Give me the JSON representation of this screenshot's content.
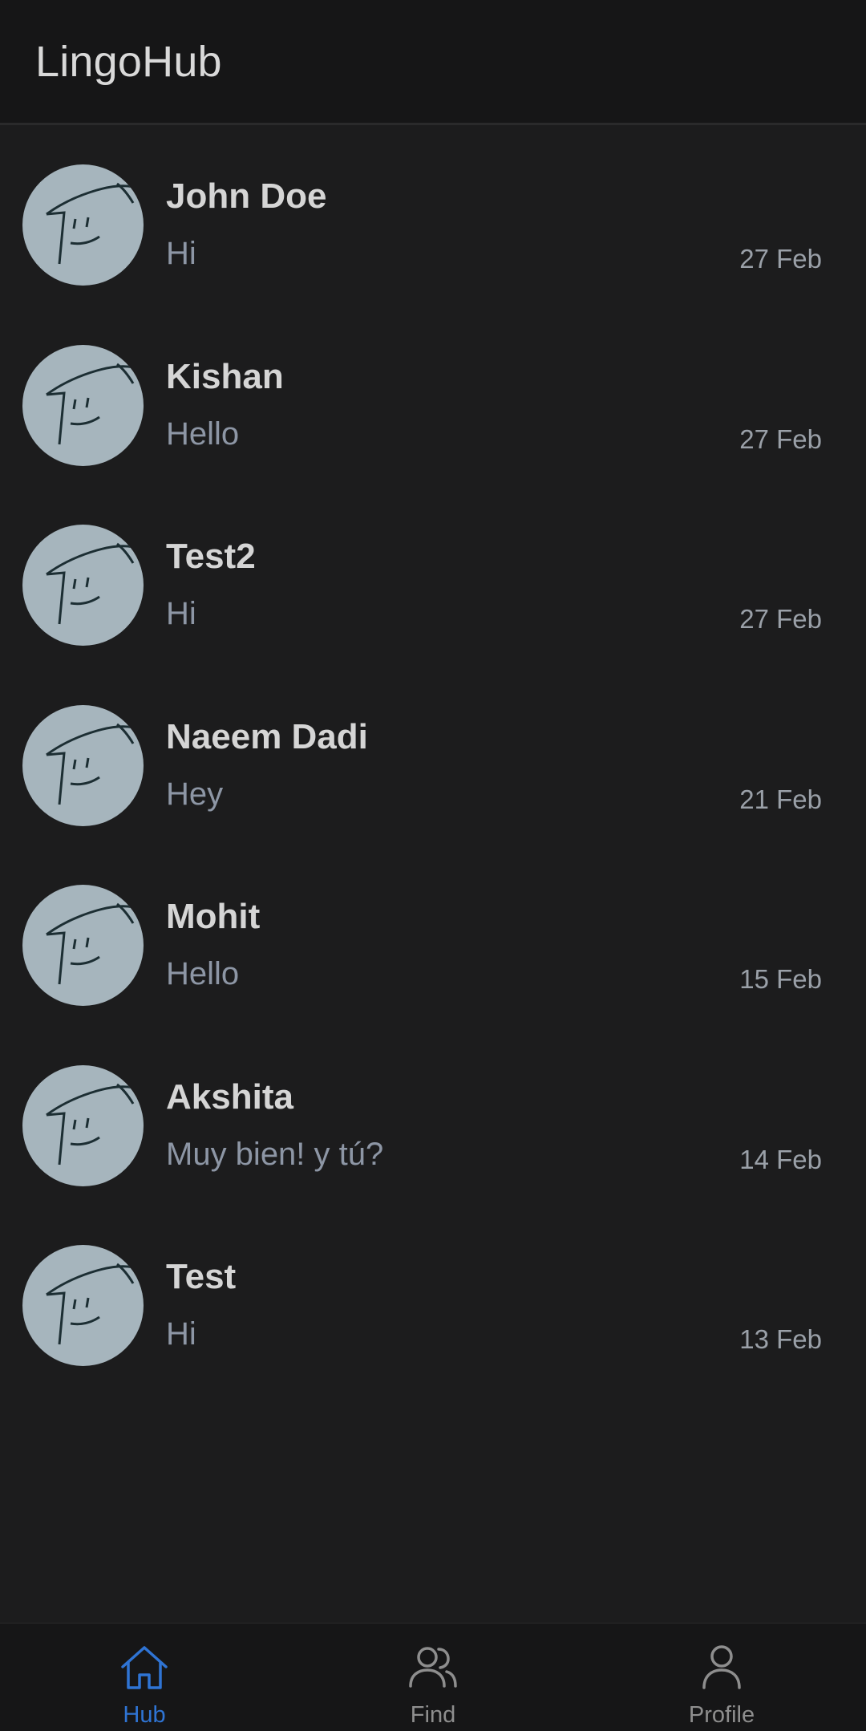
{
  "app_bar": {
    "title": "LingoHub"
  },
  "chats": [
    {
      "name": "John Doe",
      "preview": "Hi",
      "date": "27 Feb"
    },
    {
      "name": "Kishan",
      "preview": "Hello",
      "date": "27 Feb"
    },
    {
      "name": "Test2",
      "preview": "Hi",
      "date": "27 Feb"
    },
    {
      "name": "Naeem Dadi",
      "preview": "Hey",
      "date": "21 Feb"
    },
    {
      "name": "Mohit",
      "preview": "Hello",
      "date": "15 Feb"
    },
    {
      "name": "Akshita",
      "preview": "Muy bien! y tú?",
      "date": "14 Feb"
    },
    {
      "name": "Test",
      "preview": "Hi",
      "date": "13 Feb"
    }
  ],
  "bottom_nav": {
    "items": [
      {
        "label": "Hub",
        "icon": "home-icon",
        "active": true
      },
      {
        "label": "Find",
        "icon": "users-icon",
        "active": false
      },
      {
        "label": "Profile",
        "icon": "user-icon",
        "active": false
      }
    ]
  },
  "colors": {
    "background": "#1c1c1d",
    "app_bar": "#161617",
    "accent": "#2f74d4",
    "avatar_bg": "#a6b5bd"
  }
}
